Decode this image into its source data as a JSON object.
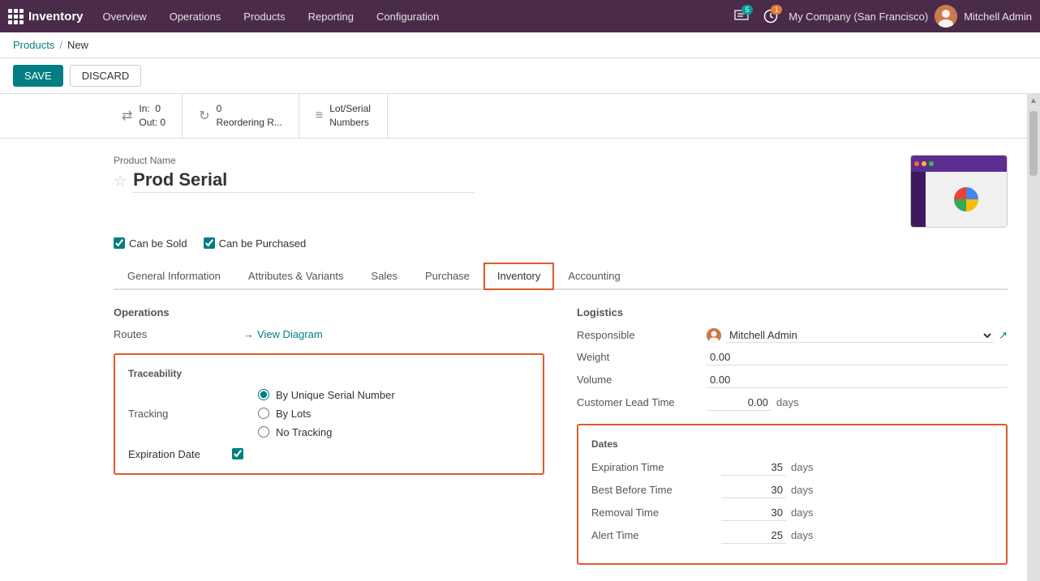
{
  "topnav": {
    "app_name": "Inventory",
    "menu_items": [
      "Overview",
      "Operations",
      "Products",
      "Reporting",
      "Configuration"
    ],
    "notifications_badge": "5",
    "updates_badge": "1",
    "company": "My Company (San Francisco)",
    "user_name": "Mitchell Admin"
  },
  "breadcrumb": {
    "parent": "Products",
    "current": "New"
  },
  "toolbar": {
    "save_label": "SAVE",
    "discard_label": "DISCARD"
  },
  "smart_buttons": [
    {
      "icon": "⇄",
      "line1": "In:",
      "val1": "0",
      "line2": "Out:",
      "val2": "0"
    },
    {
      "icon": "↻",
      "val1": "0",
      "label": "Reordering R..."
    },
    {
      "icon": "≡",
      "label": "Lot/Serial Numbers"
    }
  ],
  "product": {
    "name_label": "Product Name",
    "name": "Prod Serial",
    "can_be_sold": true,
    "can_be_sold_label": "Can be Sold",
    "can_be_purchased": true,
    "can_be_purchased_label": "Can be Purchased"
  },
  "tabs": [
    {
      "id": "general",
      "label": "General Information"
    },
    {
      "id": "attributes",
      "label": "Attributes & Variants"
    },
    {
      "id": "sales",
      "label": "Sales"
    },
    {
      "id": "purchase",
      "label": "Purchase"
    },
    {
      "id": "inventory",
      "label": "Inventory",
      "active": true
    },
    {
      "id": "accounting",
      "label": "Accounting"
    }
  ],
  "operations_section": {
    "title": "Operations",
    "routes_label": "Routes",
    "view_diagram_label": "View Diagram"
  },
  "logistics_section": {
    "title": "Logistics",
    "responsible_label": "Responsible",
    "responsible_value": "Mitchell Admin",
    "weight_label": "Weight",
    "weight_value": "0.00",
    "volume_label": "Volume",
    "volume_value": "0.00",
    "customer_lead_time_label": "Customer Lead Time",
    "customer_lead_time_value": "0.00",
    "days_label": "days"
  },
  "traceability_section": {
    "title": "Traceability",
    "tracking_label": "Tracking",
    "options": [
      {
        "id": "serial",
        "label": "By Unique Serial Number",
        "selected": true
      },
      {
        "id": "lots",
        "label": "By Lots",
        "selected": false
      },
      {
        "id": "none",
        "label": "No Tracking",
        "selected": false
      }
    ],
    "expiration_date_label": "Expiration Date",
    "expiration_date_checked": true
  },
  "dates_section": {
    "title": "Dates",
    "fields": [
      {
        "label": "Expiration Time",
        "value": "35",
        "unit": "days"
      },
      {
        "label": "Best Before Time",
        "value": "30",
        "unit": "days"
      },
      {
        "label": "Removal Time",
        "value": "30",
        "unit": "days"
      },
      {
        "label": "Alert Time",
        "value": "25",
        "unit": "days"
      }
    ]
  }
}
